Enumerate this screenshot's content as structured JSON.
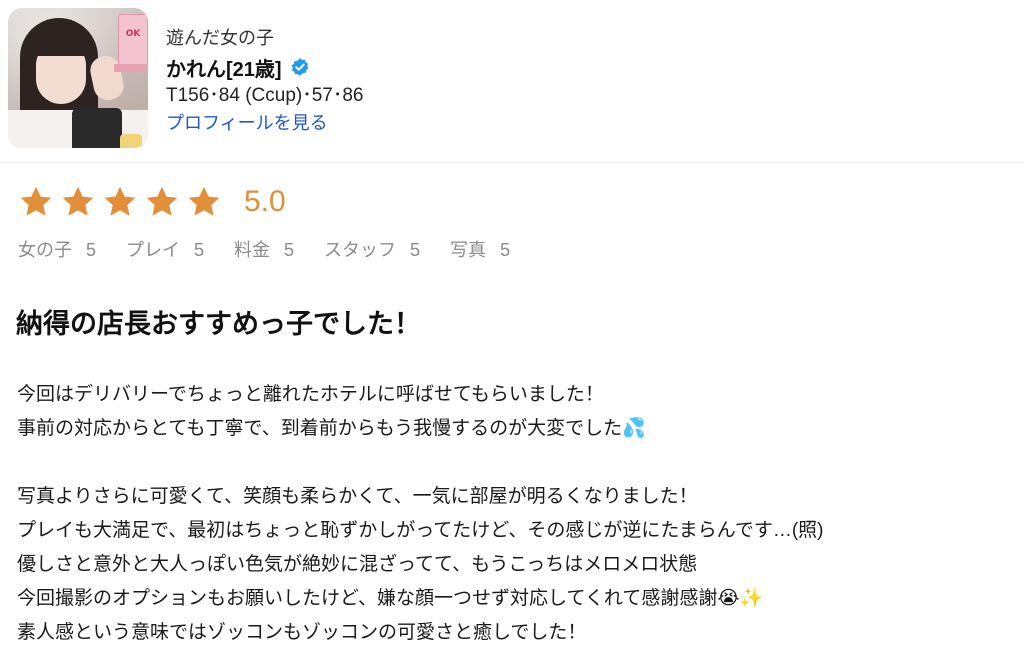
{
  "profile": {
    "played_label": "遊んだ女の子",
    "name": "かれん[21歳]",
    "stats": "T156･84 (Ccup)･57･86",
    "profile_link": "プロフィールを見る",
    "avatar_badge": "OK"
  },
  "rating": {
    "stars": 5,
    "score": "5.0",
    "star_color": "#e28f3a"
  },
  "subratings": [
    {
      "label": "女の子",
      "value": "5"
    },
    {
      "label": "プレイ",
      "value": "5"
    },
    {
      "label": "料金",
      "value": "5"
    },
    {
      "label": "スタッフ",
      "value": "5"
    },
    {
      "label": "写真",
      "value": "5"
    }
  ],
  "review": {
    "title": "納得の店長おすすめっ子でした！",
    "paragraphs": [
      [
        "今回はデリバリーでちょっと離れたホテルに呼ばせてもらいました！",
        "事前の対応からとても丁寧で、到着前からもう我慢するのが大変でした💦"
      ],
      [
        "写真よりさらに可愛くて、笑顔も柔らかくて、一気に部屋が明るくなりました！",
        "プレイも大満足で、最初はちょっと恥ずかしがってたけど、その感じが逆にたまらんです…(照)",
        "優しさと意外と大人っぽい色気が絶妙に混ざってて、もうこっちはメロメロ状態",
        "今回撮影のオプションもお願いしたけど、嫌な顔一つせず対応してくれて感謝感謝😭✨",
        "素人感という意味ではゾッコンもゾッコンの可愛さと癒しでした！"
      ]
    ]
  },
  "colors": {
    "link": "#1f58c4",
    "verified": "#1d9bf0",
    "muted": "#8b8b8b"
  }
}
